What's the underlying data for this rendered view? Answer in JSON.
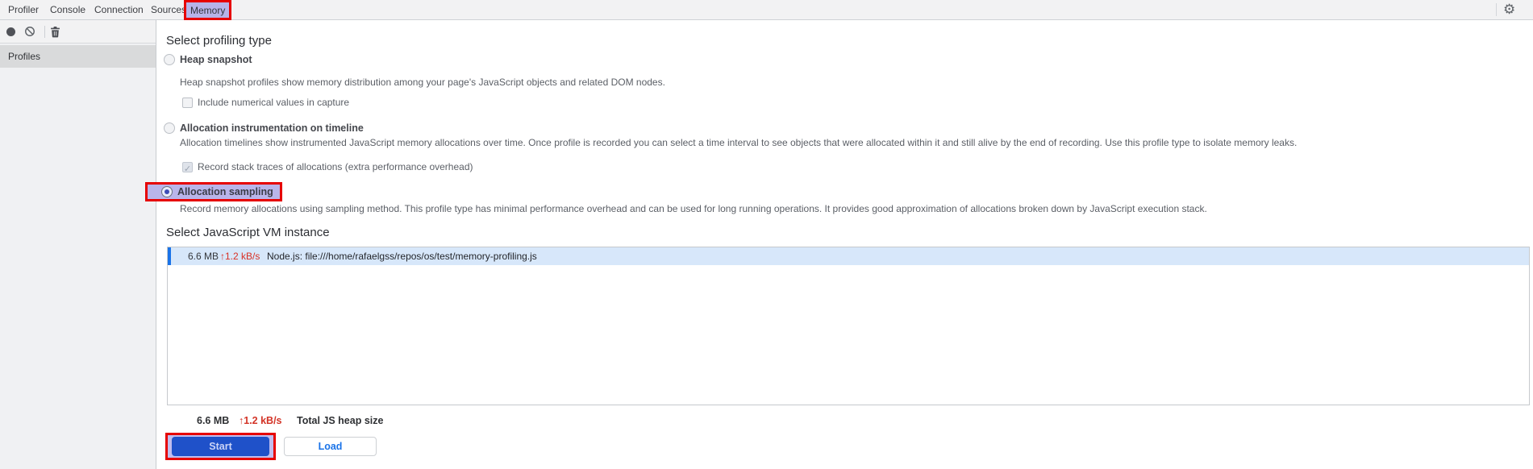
{
  "titlebar": {
    "tabs": [
      {
        "label": "Profiler"
      },
      {
        "label": "Console"
      },
      {
        "label": "Connection"
      },
      {
        "label": "Sources"
      },
      {
        "label": "Memory",
        "active": true,
        "annotated": true
      }
    ]
  },
  "glyphs": {
    "gear": "⚙",
    "check": "✓"
  },
  "sidebar": {
    "toolbar_icons": [
      "record-icon",
      "clear-icon",
      "trash-icon"
    ],
    "profiles_label": "Profiles"
  },
  "profiling": {
    "heading": "Select profiling type",
    "options": [
      {
        "label": "Heap snapshot",
        "selected": false,
        "description": "Heap snapshot profiles show memory distribution among your page's JavaScript objects and related DOM nodes."
      },
      {
        "label": "Allocation instrumentation on timeline",
        "selected": false,
        "description": "Allocation timelines show instrumented JavaScript memory allocations over time. Once profile is recorded you can select a time interval to see objects that were allocated within it and still alive by the end of recording. Use this profile type to isolate memory leaks."
      },
      {
        "label": "Allocation sampling",
        "selected": true,
        "annotated": true,
        "description": "Record memory allocations using sampling method. This profile type has minimal performance overhead and can be used for long running operations. It provides good approximation of allocations broken down by JavaScript execution stack."
      }
    ],
    "heap_checkbox": {
      "label": "Include numerical values in capture",
      "checked": false
    },
    "timeline_checkbox": {
      "label": "Record stack traces of allocations (extra performance overhead)",
      "checked": true,
      "disabled": true
    }
  },
  "vm_section": {
    "heading": "Select JavaScript VM instance",
    "instances": [
      {
        "heap_size": "6.6 MB",
        "rate": "↑1.2 kB/s",
        "name": "Node.js: file:///home/rafaelgss/repos/os/test/memory-profiling.js",
        "selected": true
      }
    ],
    "total": {
      "heap_size": "6.6 MB",
      "rate": "↑1.2 kB/s",
      "label": "Total JS heap size"
    }
  },
  "actions": {
    "start": "Start",
    "load": "Load"
  },
  "colors": {
    "accent_blue": "#1a73e8",
    "annotation_red": "#e60000",
    "annotation_purple": "#b9b5ea",
    "selected_row_blue": "#d7e7fa",
    "rate_red": "#d93025",
    "start_button_blue": "#1f51c9"
  }
}
